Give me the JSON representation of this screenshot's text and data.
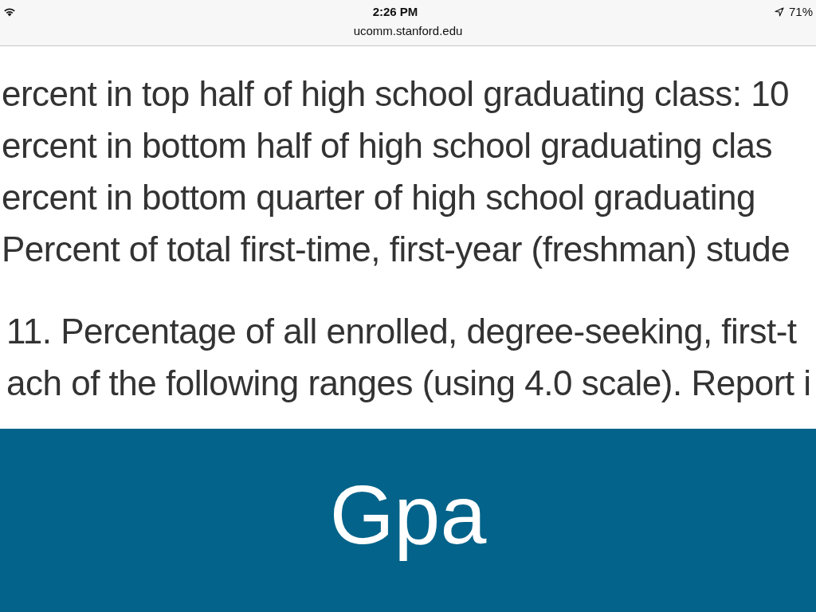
{
  "status_bar": {
    "time": "2:26 PM",
    "url": "ucomm.stanford.edu",
    "battery": "71%"
  },
  "content": {
    "list_lines": [
      "ercent in top half of high school graduating class: 10",
      "ercent in bottom half of high school graduating clas",
      "ercent in bottom quarter of high school graduating",
      "Percent of total first-time, first-year (freshman) stude"
    ],
    "question_lines": [
      "11. Percentage of all enrolled, degree-seeking, first-t",
      "ach of the following ranges (using 4.0 scale). Report i"
    ]
  },
  "banner": {
    "title": "Gpa"
  }
}
